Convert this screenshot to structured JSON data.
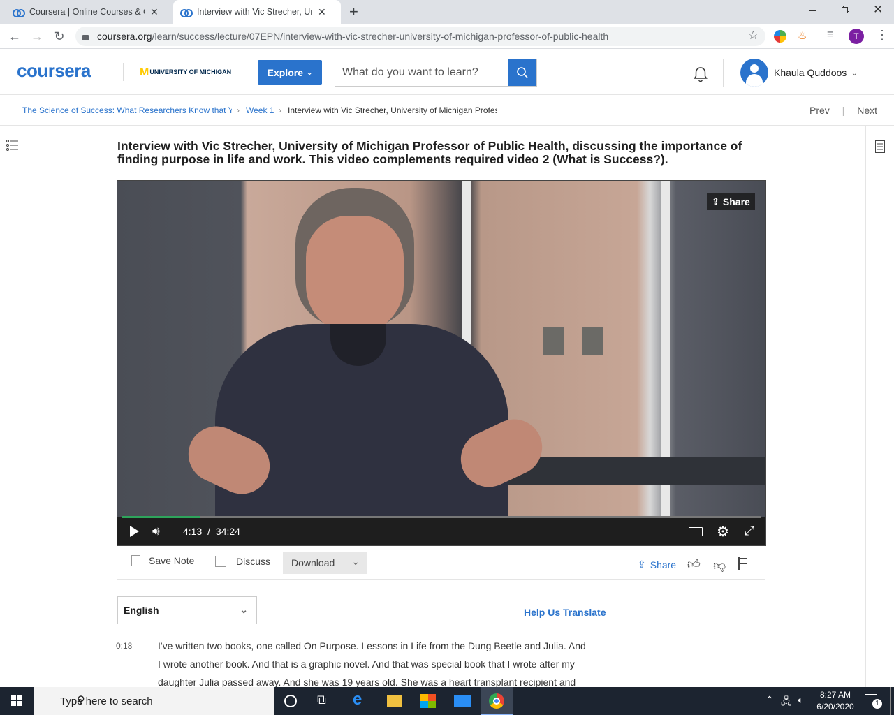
{
  "browser": {
    "tabs": [
      {
        "title": "Coursera | Online Courses & Cred",
        "active": false
      },
      {
        "title": "Interview with Vic Strecher, Unive",
        "active": true
      }
    ],
    "new_tab": "+",
    "url_host": "coursera.org",
    "url_path": "/learn/success/lecture/07EPN/interview-with-vic-strecher-university-of-michigan-professor-of-public-health",
    "profile_initial": "T"
  },
  "header": {
    "logo": "coursera",
    "partner": "UNIVERSITY OF MICHIGAN",
    "partner_mark": "M",
    "explore_label": "Explore",
    "search_placeholder": "What do you want to learn?",
    "user_name": "Khaula Quddoos"
  },
  "breadcrumb": {
    "course": "The Science of Success: What Researchers Know that Y",
    "week": "Week 1",
    "current": "Interview with Vic Strecher, University of Michigan Profes",
    "prev": "Prev",
    "next": "Next"
  },
  "lecture": {
    "title": "Interview with Vic Strecher, University of Michigan Professor of Public Health, discussing the importance of finding purpose in life and work. This video complements required video 2 (What is Success?).",
    "video_share": "Share",
    "current_time": "4:13",
    "separator": "/",
    "duration": "34:24",
    "progress_fraction": 0.123
  },
  "actions": {
    "save_note": "Save Note",
    "discuss": "Discuss",
    "download": "Download",
    "share": "Share"
  },
  "language": {
    "selected": "English",
    "help_translate": "Help Us Translate"
  },
  "transcript": {
    "timestamp": "0:18",
    "lines": [
      "I've written two books, one called On Purpose. Lessons in Life from the Dung Beetle and Julia. And",
      "I wrote another book. And that is a graphic novel. And that was special book that I wrote after my",
      "daughter Julia passed away. And she was 19 years old. She was a heart transplant recipient and"
    ]
  },
  "taskbar": {
    "search_placeholder": "Type here to search",
    "time": "8:27 AM",
    "date": "6/20/2020",
    "notification_count": "1"
  },
  "colors": {
    "brand": "#2a73cc",
    "tabstrip": "#dee1e6",
    "taskbar": "#1c2430"
  }
}
